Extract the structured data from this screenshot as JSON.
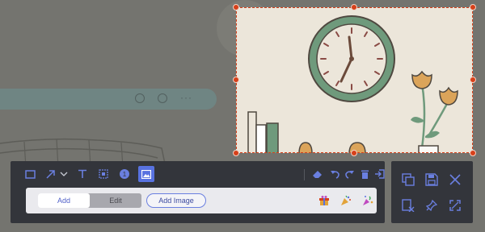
{
  "subpanel": {
    "tabs": [
      {
        "label": "Add"
      },
      {
        "label": "Edit"
      }
    ],
    "add_image_label": "Add Image"
  },
  "colors": {
    "accent": "#5872e0",
    "selection": "#d6401a",
    "panel": "#33353b",
    "clock_ring": "#6f9a7c",
    "flower": "#dba45a"
  },
  "tools": [
    "rectangle-icon",
    "arrow-icon",
    "text-icon",
    "mosaic-icon",
    "step-number-icon",
    "image-icon"
  ],
  "actions": [
    "eraser-icon",
    "undo-icon",
    "redo-icon",
    "delete-icon",
    "exit-icon"
  ],
  "side_actions": [
    "copy-icon",
    "save-icon",
    "close-icon",
    "cancel-pin-icon",
    "pin-icon",
    "fullscreen-icon"
  ],
  "stickers": [
    "sticker-gift-icon",
    "sticker-confetti-icon",
    "sticker-party-icon"
  ]
}
